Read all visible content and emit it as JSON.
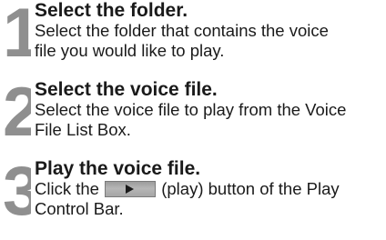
{
  "steps": [
    {
      "number": "1",
      "title": "Select the folder.",
      "body_lines": [
        "Select the folder that contains the voice",
        "file you would like to play."
      ]
    },
    {
      "number": "2",
      "title": "Select the voice file.",
      "body_lines": [
        "Select the voice file to play from the Voice",
        "File List Box."
      ]
    },
    {
      "number": "3",
      "title": "Play the voice file.",
      "body_line1_before": "Click the",
      "body_line1_after": "(play) button of the Play",
      "body_line2": "Control Bar.",
      "button_icon": "play-icon"
    }
  ],
  "colors": {
    "step_number": "#8f8f8f",
    "text": "#1a1a1a",
    "button_face": "#aaaaaa"
  }
}
